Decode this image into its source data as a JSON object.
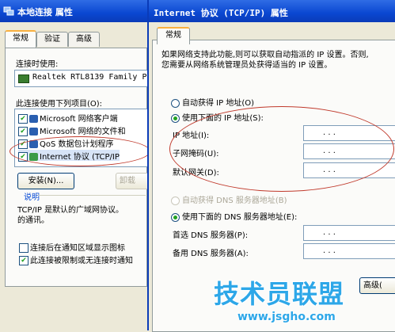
{
  "back_window": {
    "title": "本地连接 属性",
    "tabs": [
      "常规",
      "验证",
      "高级"
    ],
    "connect_using_label": "连接时使用:",
    "adapter_name": "Realtek RTL8139 Family P",
    "components_label": "此连接使用下列项目(O):",
    "components": [
      {
        "label": "Microsoft 网络客户端",
        "checked": true
      },
      {
        "label": "Microsoft 网络的文件和",
        "checked": true
      },
      {
        "label": "QoS 数据包计划程序",
        "checked": true
      },
      {
        "label": "Internet 协议 (TCP/IP",
        "checked": true
      }
    ],
    "install_button": "安装(N)...",
    "uninstall_button": "卸载",
    "description_title": "说明",
    "description_text": "TCP/IP 是默认的广域网协议。的通讯。",
    "description_line1": "TCP/IP 是默认的广域网协议。",
    "description_line2": "的通讯。",
    "show_icon_checkbox": "连接后在通知区域显示图标",
    "notify_checkbox": "此连接被限制或无连接时通知"
  },
  "front_window": {
    "title": "Internet 协议 (TCP/IP) 属性",
    "tab": "常规",
    "description_line1": "如果网络支持此功能,则可以获取自动指派的 IP 设置。否则,",
    "description_line2": "您需要从网络系统管理员处获得适当的 IP 设置。",
    "auto_ip_radio": "自动获得 IP 地址(O)",
    "manual_ip_radio": "使用下面的 IP 地址(S):",
    "ip_address_label": "IP 地址(I):",
    "subnet_label": "子网掩码(U):",
    "gateway_label": "默认网关(D):",
    "auto_dns_radio": "自动获得 DNS 服务器地址(B)",
    "manual_dns_radio": "使用下面的 DNS 服务器地址(E):",
    "preferred_dns_label": "首选 DNS 服务器(P):",
    "alternate_dns_label": "备用 DNS 服务器(A):",
    "advanced_button": "高级(",
    "ip_dots": ". . ."
  },
  "watermark": {
    "logo_text": "技术员联盟",
    "url": "www.jsgho.com"
  },
  "colors": {
    "title_bar": "#0a47d1",
    "annotation_oval": "#c0392b",
    "watermark": "#2da7e8"
  }
}
